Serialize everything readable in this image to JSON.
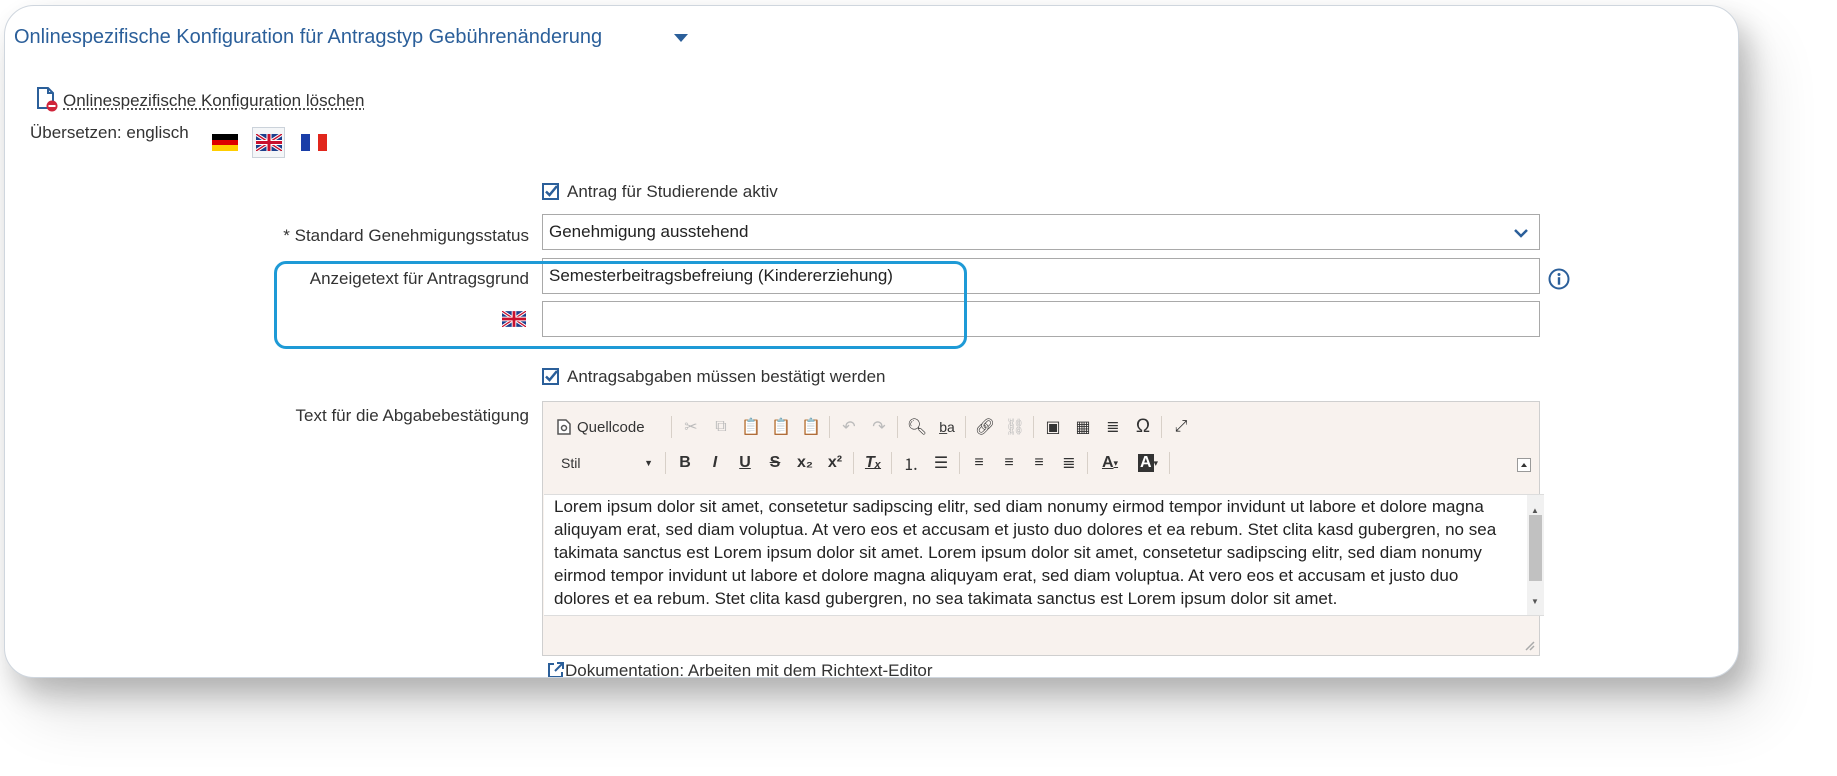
{
  "header": {
    "title": "Onlinespezifische Konfiguration für Antragstyp Gebührenänderung"
  },
  "delete_link": {
    "label": "Onlinespezifische Konfiguration löschen"
  },
  "translate": {
    "label": "Übersetzen: englisch"
  },
  "form": {
    "active_checkbox": {
      "label": "Antrag für Studierende aktiv",
      "checked": true
    },
    "status": {
      "label": "* Standard Genehmigungsstatus",
      "value": "Genehmigung ausstehend"
    },
    "reason": {
      "label": "Anzeigetext für Antragsgrund",
      "value": "Semesterbeitragsbefreiung (Kindererziehung)",
      "translation_value": ""
    },
    "confirm_checkbox": {
      "label": "Antragsabgaben müssen bestätigt werden",
      "checked": true
    },
    "confirmation_text": {
      "label": "Text für die Abgabebestätigung"
    }
  },
  "editor": {
    "source_label": "Quellcode",
    "style_label": "Stil",
    "content": "Lorem ipsum dolor sit amet, consetetur sadipscing elitr, sed diam nonumy eirmod tempor invidunt ut labore et dolore magna aliquyam erat, sed diam voluptua. At vero eos et accusam et justo duo dolores et ea rebum. Stet clita kasd gubergren, no sea takimata sanctus est Lorem ipsum dolor sit amet. Lorem ipsum dolor sit amet, consetetur sadipscing elitr, sed diam nonumy eirmod tempor invidunt ut labore et dolore magna aliquyam erat, sed diam voluptua. At vero eos et accusam et justo duo dolores et ea rebum. Stet clita kasd gubergren, no sea takimata sanctus est Lorem ipsum dolor sit amet."
  },
  "doc_link": {
    "label": "Dokumentation: Arbeiten mit dem Richtext-Editor"
  },
  "colors": {
    "accent": "#2b5f9a",
    "highlight": "#1e9ad6",
    "editor_bg": "#f8f2ee"
  }
}
